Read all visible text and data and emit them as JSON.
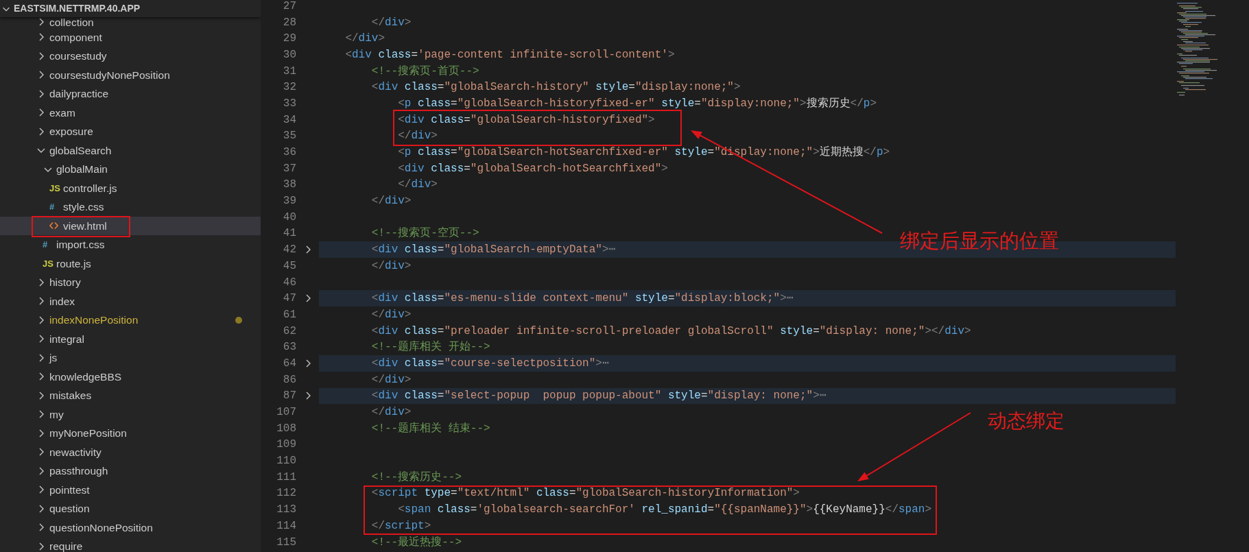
{
  "sidebar": {
    "title": "EASTSIM.NETTRMP.40.APP",
    "expanded": true,
    "items": [
      {
        "name": "collection",
        "kind": "folder",
        "expanded": false,
        "selected": false,
        "modified": false
      },
      {
        "name": "component",
        "kind": "folder",
        "expanded": false,
        "selected": false,
        "modified": false
      },
      {
        "name": "coursestudy",
        "kind": "folder",
        "expanded": false,
        "selected": false,
        "modified": false
      },
      {
        "name": "coursestudyNonePosition",
        "kind": "folder",
        "expanded": false,
        "selected": false,
        "modified": false
      },
      {
        "name": "dailypractice",
        "kind": "folder",
        "expanded": false,
        "selected": false,
        "modified": false
      },
      {
        "name": "exam",
        "kind": "folder",
        "expanded": false,
        "selected": false,
        "modified": false
      },
      {
        "name": "exposure",
        "kind": "folder",
        "expanded": false,
        "selected": false,
        "modified": false
      },
      {
        "name": "globalSearch",
        "kind": "folder",
        "expanded": true,
        "selected": false,
        "modified": false,
        "children": [
          {
            "name": "globalMain",
            "kind": "folder",
            "expanded": true,
            "selected": false,
            "modified": false,
            "children": [
              {
                "name": "controller.js",
                "kind": "js",
                "icon_text": "JS",
                "selected": false,
                "modified": false
              },
              {
                "name": "style.css",
                "kind": "css",
                "icon_text": "#",
                "selected": false,
                "modified": false
              },
              {
                "name": "view.html",
                "kind": "html",
                "selected": true,
                "modified": false
              }
            ]
          },
          {
            "name": "import.css",
            "kind": "css",
            "icon_text": "#",
            "selected": false,
            "modified": false
          },
          {
            "name": "route.js",
            "kind": "js",
            "icon_text": "JS",
            "selected": false,
            "modified": false
          }
        ]
      },
      {
        "name": "history",
        "kind": "folder",
        "expanded": false,
        "selected": false,
        "modified": false
      },
      {
        "name": "index",
        "kind": "folder",
        "expanded": false,
        "selected": false,
        "modified": false
      },
      {
        "name": "indexNonePosition",
        "kind": "folder",
        "expanded": false,
        "selected": false,
        "modified": true
      },
      {
        "name": "integral",
        "kind": "folder",
        "expanded": false,
        "selected": false,
        "modified": false
      },
      {
        "name": "js",
        "kind": "folder",
        "expanded": false,
        "selected": false,
        "modified": false
      },
      {
        "name": "knowledgeBBS",
        "kind": "folder",
        "expanded": false,
        "selected": false,
        "modified": false
      },
      {
        "name": "mistakes",
        "kind": "folder",
        "expanded": false,
        "selected": false,
        "modified": false
      },
      {
        "name": "my",
        "kind": "folder",
        "expanded": false,
        "selected": false,
        "modified": false
      },
      {
        "name": "myNonePosition",
        "kind": "folder",
        "expanded": false,
        "selected": false,
        "modified": false
      },
      {
        "name": "newactivity",
        "kind": "folder",
        "expanded": false,
        "selected": false,
        "modified": false
      },
      {
        "name": "passthrough",
        "kind": "folder",
        "expanded": false,
        "selected": false,
        "modified": false
      },
      {
        "name": "pointtest",
        "kind": "folder",
        "expanded": false,
        "selected": false,
        "modified": false
      },
      {
        "name": "question",
        "kind": "folder",
        "expanded": false,
        "selected": false,
        "modified": false
      },
      {
        "name": "questionNonePosition",
        "kind": "folder",
        "expanded": false,
        "selected": false,
        "modified": false
      },
      {
        "name": "require",
        "kind": "folder",
        "expanded": false,
        "selected": false,
        "modified": false
      }
    ]
  },
  "editor": {
    "lines": [
      {
        "number": "27",
        "folded": false
      },
      {
        "number": "28",
        "folded": false,
        "tokens": [
          {
            "kind": "punct",
            "text": "        </"
          },
          {
            "kind": "tag",
            "text": "div"
          },
          {
            "kind": "punct",
            "text": ">"
          }
        ]
      },
      {
        "number": "29",
        "folded": false,
        "tokens": [
          {
            "kind": "punct",
            "text": "    </"
          },
          {
            "kind": "tag",
            "text": "div"
          },
          {
            "kind": "punct",
            "text": ">"
          }
        ]
      },
      {
        "number": "30",
        "folded": false,
        "tokens": [
          {
            "kind": "punct",
            "text": "    <"
          },
          {
            "kind": "tag",
            "text": "div"
          },
          {
            "kind": "attr",
            "text": " class"
          },
          {
            "kind": "text",
            "text": "="
          },
          {
            "kind": "string",
            "text": "'page-content infinite-scroll-content'"
          },
          {
            "kind": "punct",
            "text": ">"
          }
        ]
      },
      {
        "number": "31",
        "folded": false,
        "tokens": [
          {
            "kind": "comment",
            "text": "        <!--搜索页-首页-->"
          }
        ]
      },
      {
        "number": "32",
        "folded": false,
        "tokens": [
          {
            "kind": "punct",
            "text": "        <"
          },
          {
            "kind": "tag",
            "text": "div"
          },
          {
            "kind": "attr",
            "text": " class"
          },
          {
            "kind": "text",
            "text": "="
          },
          {
            "kind": "string",
            "text": "\"globalSearch-history\""
          },
          {
            "kind": "attr",
            "text": " style"
          },
          {
            "kind": "text",
            "text": "="
          },
          {
            "kind": "string",
            "text": "\"display:none;\""
          },
          {
            "kind": "punct",
            "text": ">"
          }
        ]
      },
      {
        "number": "33",
        "folded": false,
        "tokens": [
          {
            "kind": "punct",
            "text": "            <"
          },
          {
            "kind": "tag",
            "text": "p"
          },
          {
            "kind": "attr",
            "text": " class"
          },
          {
            "kind": "text",
            "text": "="
          },
          {
            "kind": "string",
            "text": "\"globalSearch-historyfixed-er\""
          },
          {
            "kind": "attr",
            "text": " style"
          },
          {
            "kind": "text",
            "text": "="
          },
          {
            "kind": "string",
            "text": "\"display:none;\""
          },
          {
            "kind": "punct",
            "text": ">"
          },
          {
            "kind": "text",
            "text": "搜索历史"
          },
          {
            "kind": "punct",
            "text": "</"
          },
          {
            "kind": "tag",
            "text": "p"
          },
          {
            "kind": "punct",
            "text": ">"
          }
        ]
      },
      {
        "number": "34",
        "folded": false,
        "tokens": [
          {
            "kind": "punct",
            "text": "            <"
          },
          {
            "kind": "tag",
            "text": "div"
          },
          {
            "kind": "attr",
            "text": " class"
          },
          {
            "kind": "text",
            "text": "="
          },
          {
            "kind": "string",
            "text": "\"globalSearch-historyfixed\""
          },
          {
            "kind": "punct",
            "text": ">"
          }
        ]
      },
      {
        "number": "35",
        "folded": false,
        "tokens": [
          {
            "kind": "punct",
            "text": "            </"
          },
          {
            "kind": "tag",
            "text": "div"
          },
          {
            "kind": "punct",
            "text": ">"
          }
        ]
      },
      {
        "number": "36",
        "folded": false,
        "tokens": [
          {
            "kind": "punct",
            "text": "            <"
          },
          {
            "kind": "tag",
            "text": "p"
          },
          {
            "kind": "attr",
            "text": " class"
          },
          {
            "kind": "text",
            "text": "="
          },
          {
            "kind": "string",
            "text": "\"globalSearch-hotSearchfixed-er\""
          },
          {
            "kind": "attr",
            "text": " style"
          },
          {
            "kind": "text",
            "text": "="
          },
          {
            "kind": "string",
            "text": "\"display:none;\""
          },
          {
            "kind": "punct",
            "text": ">"
          },
          {
            "kind": "text",
            "text": "近期热搜"
          },
          {
            "kind": "punct",
            "text": "</"
          },
          {
            "kind": "tag",
            "text": "p"
          },
          {
            "kind": "punct",
            "text": ">"
          }
        ]
      },
      {
        "number": "37",
        "folded": false,
        "tokens": [
          {
            "kind": "punct",
            "text": "            <"
          },
          {
            "kind": "tag",
            "text": "div"
          },
          {
            "kind": "attr",
            "text": " class"
          },
          {
            "kind": "text",
            "text": "="
          },
          {
            "kind": "string",
            "text": "\"globalSearch-hotSearchfixed\""
          },
          {
            "kind": "punct",
            "text": ">"
          }
        ]
      },
      {
        "number": "38",
        "folded": false,
        "tokens": [
          {
            "kind": "punct",
            "text": "            </"
          },
          {
            "kind": "tag",
            "text": "div"
          },
          {
            "kind": "punct",
            "text": ">"
          }
        ]
      },
      {
        "number": "39",
        "folded": false,
        "tokens": [
          {
            "kind": "punct",
            "text": "        </"
          },
          {
            "kind": "tag",
            "text": "div"
          },
          {
            "kind": "punct",
            "text": ">"
          }
        ]
      },
      {
        "number": "40",
        "folded": false
      },
      {
        "number": "41",
        "folded": false,
        "tokens": [
          {
            "kind": "comment",
            "text": "        <!--搜索页-空页-->"
          }
        ]
      },
      {
        "number": "42",
        "folded": true,
        "tokens": [
          {
            "kind": "punct",
            "text": "        <"
          },
          {
            "kind": "tag",
            "text": "div"
          },
          {
            "kind": "attr",
            "text": " class"
          },
          {
            "kind": "text",
            "text": "="
          },
          {
            "kind": "string",
            "text": "\"globalSearch-emptyData\""
          },
          {
            "kind": "punct",
            "text": ">"
          },
          {
            "kind": "punct",
            "text": "⋯"
          }
        ]
      },
      {
        "number": "45",
        "folded": false,
        "tokens": [
          {
            "kind": "punct",
            "text": "        </"
          },
          {
            "kind": "tag",
            "text": "div"
          },
          {
            "kind": "punct",
            "text": ">"
          }
        ]
      },
      {
        "number": "46",
        "folded": false
      },
      {
        "number": "47",
        "folded": true,
        "tokens": [
          {
            "kind": "punct",
            "text": "        <"
          },
          {
            "kind": "tag",
            "text": "div"
          },
          {
            "kind": "attr",
            "text": " class"
          },
          {
            "kind": "text",
            "text": "="
          },
          {
            "kind": "string",
            "text": "\"es-menu-slide context-menu\""
          },
          {
            "kind": "attr",
            "text": " style"
          },
          {
            "kind": "text",
            "text": "="
          },
          {
            "kind": "string",
            "text": "\"display:block;\""
          },
          {
            "kind": "punct",
            "text": ">"
          },
          {
            "kind": "punct",
            "text": "⋯"
          }
        ]
      },
      {
        "number": "61",
        "folded": false,
        "tokens": [
          {
            "kind": "punct",
            "text": "        </"
          },
          {
            "kind": "tag",
            "text": "div"
          },
          {
            "kind": "punct",
            "text": ">"
          }
        ]
      },
      {
        "number": "62",
        "folded": false,
        "tokens": [
          {
            "kind": "punct",
            "text": "        <"
          },
          {
            "kind": "tag",
            "text": "div"
          },
          {
            "kind": "attr",
            "text": " class"
          },
          {
            "kind": "text",
            "text": "="
          },
          {
            "kind": "string",
            "text": "\"preloader infinite-scroll-preloader globalScroll\""
          },
          {
            "kind": "attr",
            "text": " style"
          },
          {
            "kind": "text",
            "text": "="
          },
          {
            "kind": "string",
            "text": "\"display: none;\""
          },
          {
            "kind": "punct",
            "text": "></"
          },
          {
            "kind": "tag",
            "text": "div"
          },
          {
            "kind": "punct",
            "text": ">"
          }
        ]
      },
      {
        "number": "63",
        "folded": false,
        "tokens": [
          {
            "kind": "comment",
            "text": "        <!--题库相关 开始-->"
          }
        ]
      },
      {
        "number": "64",
        "folded": true,
        "tokens": [
          {
            "kind": "punct",
            "text": "        <"
          },
          {
            "kind": "tag",
            "text": "div"
          },
          {
            "kind": "attr",
            "text": " class"
          },
          {
            "kind": "text",
            "text": "="
          },
          {
            "kind": "string",
            "text": "\"course-selectposition\""
          },
          {
            "kind": "punct",
            "text": ">"
          },
          {
            "kind": "punct",
            "text": "⋯"
          }
        ]
      },
      {
        "number": "86",
        "folded": false,
        "tokens": [
          {
            "kind": "punct",
            "text": "        </"
          },
          {
            "kind": "tag",
            "text": "div"
          },
          {
            "kind": "punct",
            "text": ">"
          }
        ]
      },
      {
        "number": "87",
        "folded": true,
        "tokens": [
          {
            "kind": "punct",
            "text": "        <"
          },
          {
            "kind": "tag",
            "text": "div"
          },
          {
            "kind": "attr",
            "text": " class"
          },
          {
            "kind": "text",
            "text": "="
          },
          {
            "kind": "string",
            "text": "\"select-popup  popup popup-about\""
          },
          {
            "kind": "attr",
            "text": " style"
          },
          {
            "kind": "text",
            "text": "="
          },
          {
            "kind": "string",
            "text": "\"display: none;\""
          },
          {
            "kind": "punct",
            "text": ">"
          },
          {
            "kind": "punct",
            "text": "⋯"
          }
        ]
      },
      {
        "number": "107",
        "folded": false,
        "tokens": [
          {
            "kind": "punct",
            "text": "        </"
          },
          {
            "kind": "tag",
            "text": "div"
          },
          {
            "kind": "punct",
            "text": ">"
          }
        ]
      },
      {
        "number": "108",
        "folded": false,
        "tokens": [
          {
            "kind": "comment",
            "text": "        <!--题库相关 结束-->"
          }
        ]
      },
      {
        "number": "109",
        "folded": false
      },
      {
        "number": "110",
        "folded": false
      },
      {
        "number": "111",
        "folded": false,
        "tokens": [
          {
            "kind": "comment",
            "text": "        <!--搜索历史-->"
          }
        ]
      },
      {
        "number": "112",
        "folded": false,
        "tokens": [
          {
            "kind": "punct",
            "text": "        <"
          },
          {
            "kind": "tag",
            "text": "script"
          },
          {
            "kind": "attr",
            "text": " type"
          },
          {
            "kind": "text",
            "text": "="
          },
          {
            "kind": "string",
            "text": "\"text/html\""
          },
          {
            "kind": "attr",
            "text": " class"
          },
          {
            "kind": "text",
            "text": "="
          },
          {
            "kind": "string",
            "text": "\"globalSearch-historyInformation\""
          },
          {
            "kind": "punct",
            "text": ">"
          }
        ]
      },
      {
        "number": "113",
        "folded": false,
        "tokens": [
          {
            "kind": "punct",
            "text": "            <"
          },
          {
            "kind": "tag",
            "text": "span"
          },
          {
            "kind": "attr",
            "text": " class"
          },
          {
            "kind": "text",
            "text": "="
          },
          {
            "kind": "string",
            "text": "'globalsearch-searchFor'"
          },
          {
            "kind": "attr",
            "text": " rel_spanid"
          },
          {
            "kind": "text",
            "text": "="
          },
          {
            "kind": "string",
            "text": "\"{{spanName}}\""
          },
          {
            "kind": "punct",
            "text": ">"
          },
          {
            "kind": "text",
            "text": "{{KeyName}}"
          },
          {
            "kind": "punct",
            "text": "</"
          },
          {
            "kind": "tag",
            "text": "span"
          },
          {
            "kind": "punct",
            "text": ">"
          }
        ]
      },
      {
        "number": "114",
        "folded": false,
        "tokens": [
          {
            "kind": "punct",
            "text": "        </"
          },
          {
            "kind": "tag",
            "text": "script"
          },
          {
            "kind": "punct",
            "text": ">"
          }
        ]
      },
      {
        "number": "115",
        "folded": false,
        "tokens": [
          {
            "kind": "comment",
            "text": "        <!--最近热搜-->"
          }
        ]
      }
    ]
  },
  "annotations": [
    {
      "kind": "box"
    },
    {
      "kind": "box"
    },
    {
      "kind": "box"
    },
    {
      "kind": "arrow"
    },
    {
      "kind": "arrow"
    },
    {
      "kind": "label",
      "text": "绑定后显示的位置"
    },
    {
      "kind": "label",
      "text": "动态绑定"
    }
  ]
}
